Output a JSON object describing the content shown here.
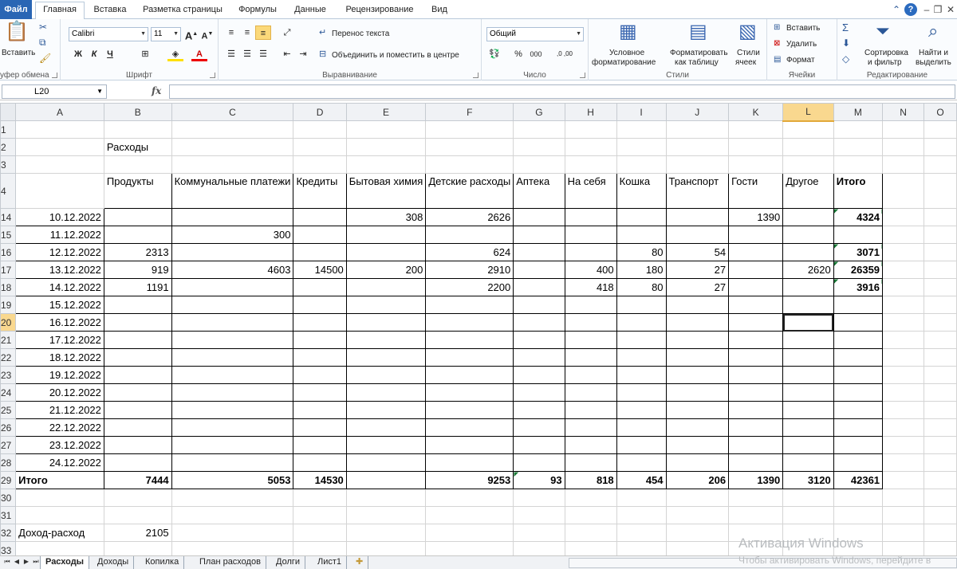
{
  "ribbon": {
    "tabs": [
      "Файл",
      "Главная",
      "Вставка",
      "Разметка страницы",
      "Формулы",
      "Данные",
      "Рецензирование",
      "Вид"
    ],
    "clipboard": {
      "paste": "Вставить",
      "label": "уфер обмена"
    },
    "font": {
      "name": "Calibri",
      "size": "11",
      "bold": "Ж",
      "italic": "К",
      "underline": "Ч",
      "label": "Шрифт"
    },
    "alignment": {
      "wrap": "Перенос текста",
      "merge": "Объединить и поместить в центре",
      "label": "Выравнивание"
    },
    "number": {
      "format": "Общий",
      "percent": "%",
      "thousands": "000",
      "inc_dec": ",0 ,00",
      "label": "Число"
    },
    "styles": {
      "conditional_1": "Условное",
      "conditional_2": "форматирование",
      "as_table_1": "Форматировать",
      "as_table_2": "как таблицу",
      "cell_styles_1": "Стили",
      "cell_styles_2": "ячеек",
      "label": "Стили"
    },
    "cells": {
      "insert": "Вставить",
      "delete": "Удалить",
      "format": "Формат",
      "label": "Ячейки"
    },
    "editing": {
      "sort_1": "Сортировка",
      "sort_2": "и фильтр",
      "find_1": "Найти и",
      "find_2": "выделить",
      "label": "Редактирование"
    }
  },
  "formula_bar": {
    "name_box": "L20",
    "fx": "fx",
    "formula": ""
  },
  "columns": [
    "A",
    "B",
    "C",
    "D",
    "E",
    "F",
    "G",
    "H",
    "I",
    "J",
    "K",
    "L",
    "M",
    "N",
    "O"
  ],
  "sheet": {
    "title_row": {
      "row": "2",
      "text": "Расходы"
    },
    "header_row": {
      "row": "4",
      "cells": [
        "",
        "Продукты",
        "Коммунальные платежи",
        "Кредиты",
        "Бытовая химия",
        "Детские расходы",
        "Аптека",
        "На себя",
        "Кошка",
        "Транспорт",
        "Гости",
        "Другое",
        "Итого"
      ]
    },
    "data_rows": [
      {
        "row": "14",
        "cells": [
          "10.12.2022",
          "",
          "",
          "",
          "308",
          "2626",
          "",
          "",
          "",
          "",
          "1390",
          "",
          "4324"
        ]
      },
      {
        "row": "15",
        "cells": [
          "11.12.2022",
          "",
          "300",
          "",
          "",
          "",
          "",
          "",
          "",
          "",
          "",
          "",
          ""
        ]
      },
      {
        "row": "16",
        "cells": [
          "12.12.2022",
          "2313",
          "",
          "",
          "",
          "624",
          "",
          "",
          "80",
          "54",
          "",
          "",
          "3071"
        ]
      },
      {
        "row": "17",
        "cells": [
          "13.12.2022",
          "919",
          "4603",
          "14500",
          "200",
          "2910",
          "",
          "400",
          "180",
          "27",
          "",
          "2620",
          "26359"
        ]
      },
      {
        "row": "18",
        "cells": [
          "14.12.2022",
          "1191",
          "",
          "",
          "",
          "2200",
          "",
          "418",
          "80",
          "27",
          "",
          "",
          "3916"
        ]
      },
      {
        "row": "19",
        "cells": [
          "15.12.2022",
          "",
          "",
          "",
          "",
          "",
          "",
          "",
          "",
          "",
          "",
          "",
          ""
        ]
      },
      {
        "row": "20",
        "cells": [
          "16.12.2022",
          "",
          "",
          "",
          "",
          "",
          "",
          "",
          "",
          "",
          "",
          "",
          ""
        ]
      },
      {
        "row": "21",
        "cells": [
          "17.12.2022",
          "",
          "",
          "",
          "",
          "",
          "",
          "",
          "",
          "",
          "",
          "",
          ""
        ]
      },
      {
        "row": "22",
        "cells": [
          "18.12.2022",
          "",
          "",
          "",
          "",
          "",
          "",
          "",
          "",
          "",
          "",
          "",
          ""
        ]
      },
      {
        "row": "23",
        "cells": [
          "19.12.2022",
          "",
          "",
          "",
          "",
          "",
          "",
          "",
          "",
          "",
          "",
          "",
          ""
        ]
      },
      {
        "row": "24",
        "cells": [
          "20.12.2022",
          "",
          "",
          "",
          "",
          "",
          "",
          "",
          "",
          "",
          "",
          "",
          ""
        ]
      },
      {
        "row": "25",
        "cells": [
          "21.12.2022",
          "",
          "",
          "",
          "",
          "",
          "",
          "",
          "",
          "",
          "",
          "",
          ""
        ]
      },
      {
        "row": "26",
        "cells": [
          "22.12.2022",
          "",
          "",
          "",
          "",
          "",
          "",
          "",
          "",
          "",
          "",
          "",
          ""
        ]
      },
      {
        "row": "27",
        "cells": [
          "23.12.2022",
          "",
          "",
          "",
          "",
          "",
          "",
          "",
          "",
          "",
          "",
          "",
          ""
        ]
      },
      {
        "row": "28",
        "cells": [
          "24.12.2022",
          "",
          "",
          "",
          "",
          "",
          "",
          "",
          "",
          "",
          "",
          "",
          ""
        ]
      }
    ],
    "total_row": {
      "row": "29",
      "cells": [
        "Итого",
        "7444",
        "5053",
        "14530",
        "",
        "9253",
        "93",
        "818",
        "454",
        "206",
        "1390",
        "3120",
        "42361"
      ]
    },
    "empty_rows": [
      "1",
      "3",
      "30",
      "31",
      "33"
    ],
    "balance_row": {
      "row": "32",
      "label": "Доход-расход",
      "value": "2105"
    }
  },
  "sheet_tabs": [
    "Расходы",
    "Доходы",
    "Копилка",
    "План расходов",
    "Долги",
    "Лист1"
  ],
  "watermark": {
    "line1": "Активация Windows",
    "line2": "Чтобы активировать Windows, перейдите в"
  }
}
